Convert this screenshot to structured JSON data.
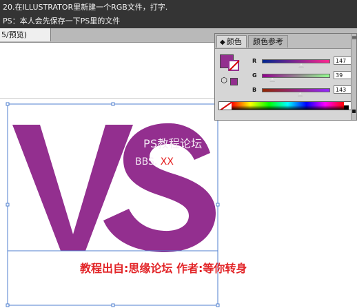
{
  "tutorial": {
    "step_text": "20.在ILLUSTRATOR里新建一个RGB文件，打字.",
    "ps_text": "PS：本人会先保存一下PS里的文件"
  },
  "document": {
    "tab_label": "5/预览)"
  },
  "artwork": {
    "letters": "VS"
  },
  "panel": {
    "tabs": {
      "color": "颜色",
      "color_guide": "颜色参考"
    },
    "channels": [
      {
        "label": "R",
        "value": "147"
      },
      {
        "label": "G",
        "value": "39"
      },
      {
        "label": "B",
        "value": "143"
      }
    ]
  },
  "watermark": {
    "title": "PS教程论坛",
    "sub_prefix": "BBS.",
    "sub_xx": "XX"
  },
  "caption": {
    "text": "教程出自:思缘论坛    作者:等你转身"
  },
  "colors": {
    "artwork_fill": "#932f8f",
    "selection": "#4f7fcf",
    "caption": "#e22427"
  },
  "icons": {
    "panel_menu": "panel-menu-icon",
    "cube": "cube-icon",
    "stroke_none": "no-fill-icon"
  }
}
